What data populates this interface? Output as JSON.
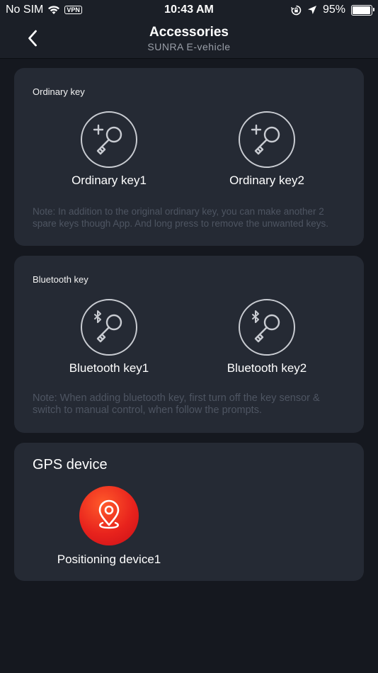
{
  "status_bar": {
    "carrier": "No SIM",
    "vpn": "VPN",
    "time": "10:43 AM",
    "battery_percent": "95%",
    "battery_level": 0.95
  },
  "nav": {
    "title": "Accessories",
    "subtitle": "SUNRA E-vehicle"
  },
  "ordinary_key": {
    "title": "Ordinary key",
    "items": [
      {
        "label": "Ordinary key1",
        "icon": "key-add-icon"
      },
      {
        "label": "Ordinary key2",
        "icon": "key-add-icon"
      }
    ],
    "note": "Note: In addition to the original ordinary key, you can make another 2 spare keys though App. And long press to remove the unwanted keys."
  },
  "bluetooth_key": {
    "title": "Bluetooth key",
    "items": [
      {
        "label": "Bluetooth key1",
        "icon": "bluetooth-key-icon"
      },
      {
        "label": "Bluetooth key2",
        "icon": "bluetooth-key-icon"
      }
    ],
    "note": "Note: When adding bluetooth key, first turn off the key sensor & switch to manual control, when follow the prompts."
  },
  "gps": {
    "title": "GPS device",
    "items": [
      {
        "label": "Positioning device1",
        "icon": "location-pin-icon"
      }
    ]
  },
  "colors": {
    "background": "#15181f",
    "card": "#252a34",
    "gps_accent": "#e8231d"
  }
}
